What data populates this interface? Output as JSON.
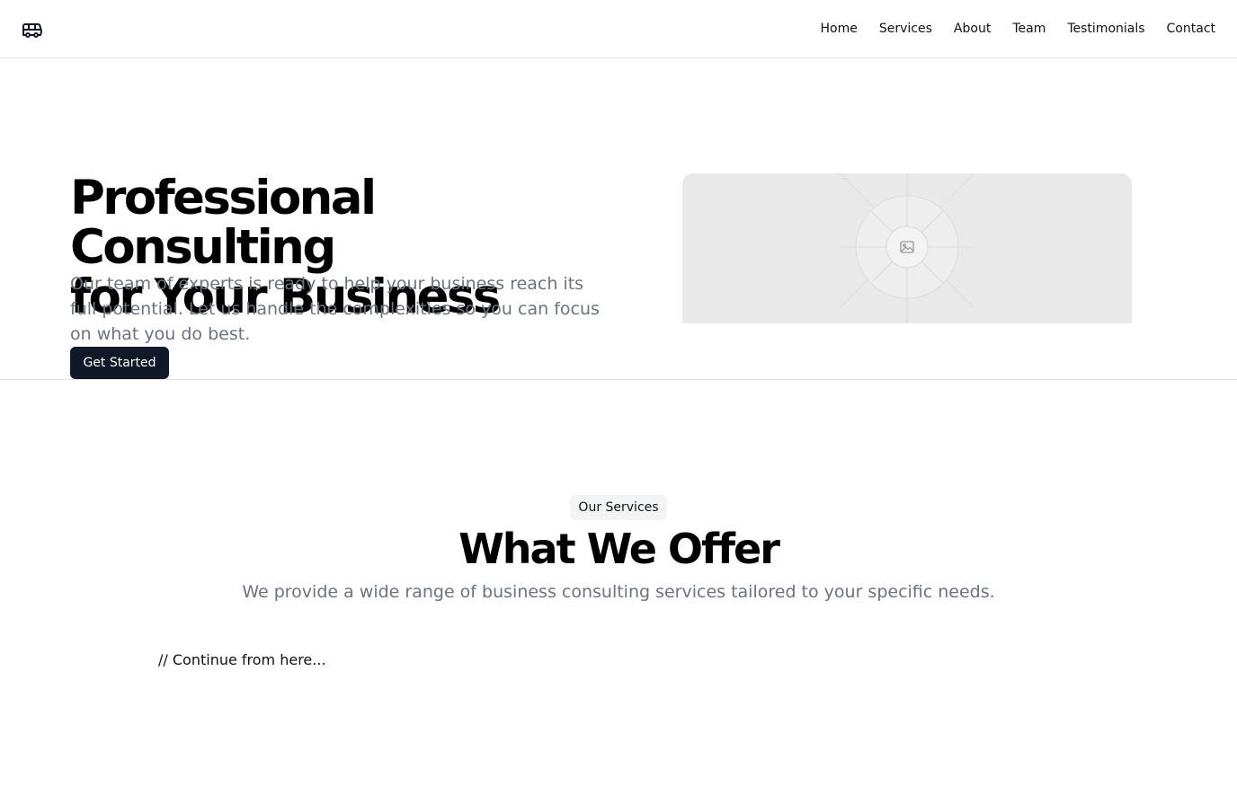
{
  "header": {
    "logo_icon": "bus-icon",
    "nav": [
      {
        "label": "Home"
      },
      {
        "label": "Services"
      },
      {
        "label": "About"
      },
      {
        "label": "Team"
      },
      {
        "label": "Testimonials"
      },
      {
        "label": "Contact"
      }
    ]
  },
  "hero": {
    "title_line1": "Professional Consulting",
    "title_line2": "for Your Business",
    "subtitle": "Our team of experts is ready to help your business reach its full potential. Let us handle the complexities so you can focus on what you do best.",
    "cta_label": "Get Started",
    "media_icon": "image-placeholder-icon"
  },
  "services": {
    "badge": "Our Services",
    "title": "What We Offer",
    "subtitle": "We provide a wide range of business consulting services tailored to your specific needs.",
    "continue_text": "// Continue from here..."
  },
  "colors": {
    "primary_button": "#111827",
    "muted_text": "#6b7280",
    "border": "#e5e7eb",
    "placeholder_bg": "#e9e9e9"
  }
}
